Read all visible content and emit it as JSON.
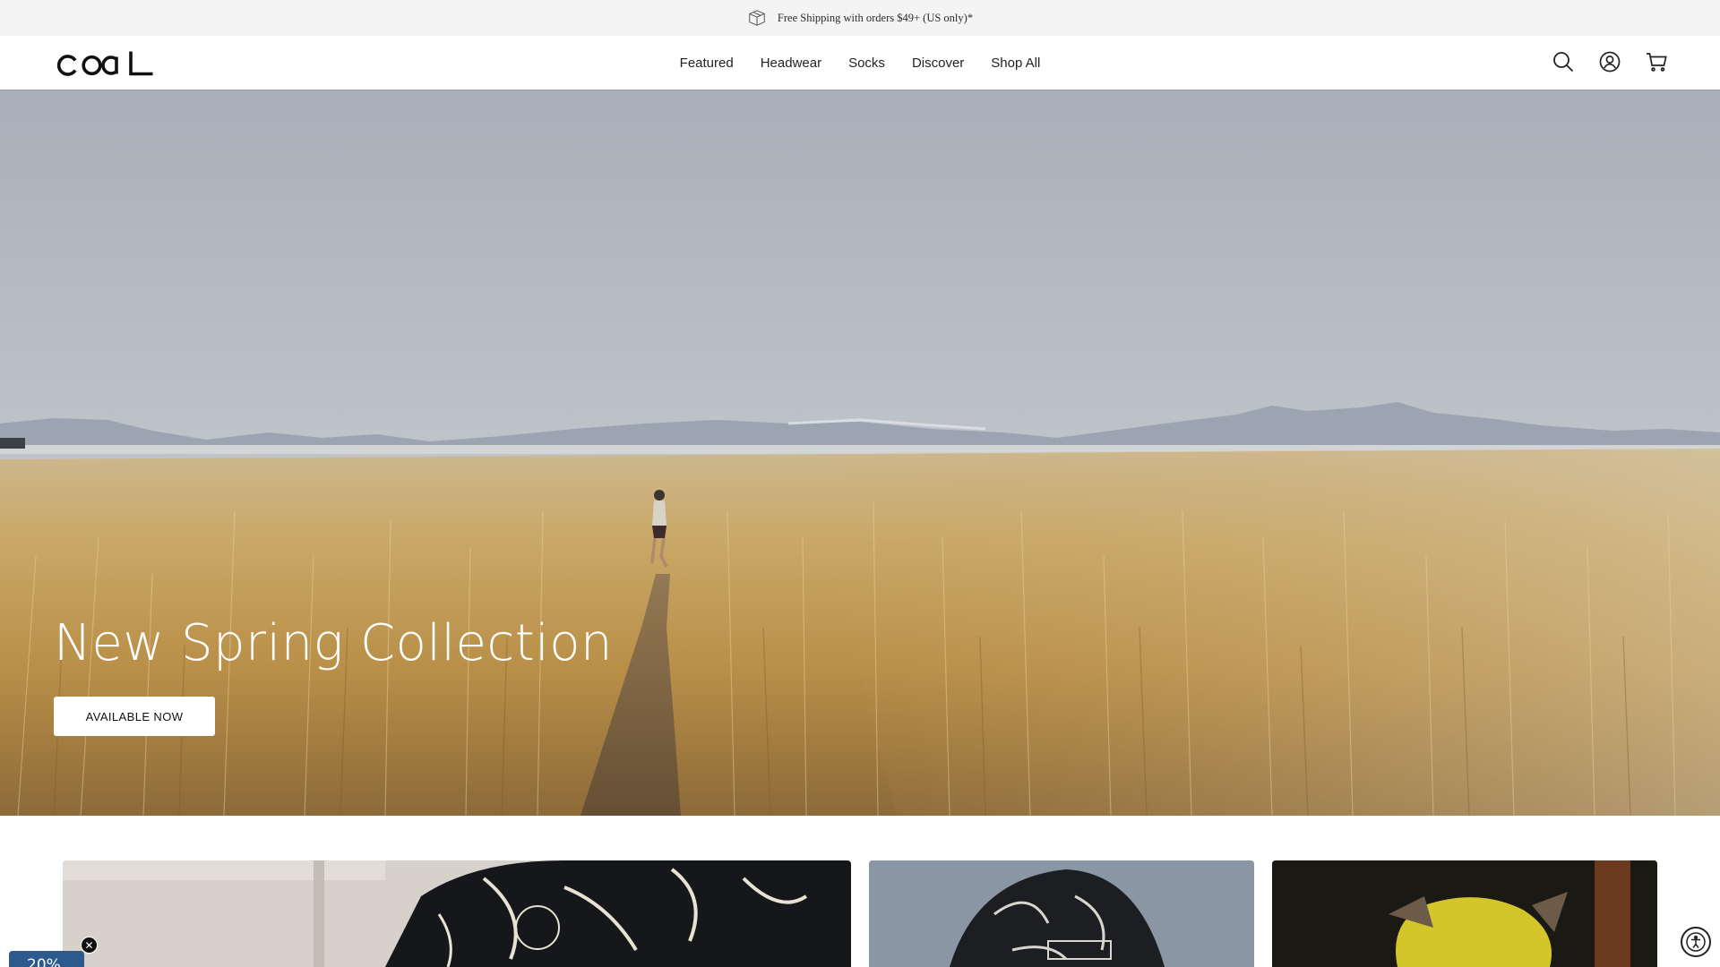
{
  "announcement": {
    "text": "Free Shipping with orders $49+ (US only)*",
    "icon": "box-icon"
  },
  "header": {
    "logo_text": "coal",
    "nav": [
      {
        "label": "Featured"
      },
      {
        "label": "Headwear"
      },
      {
        "label": "Socks"
      },
      {
        "label": "Discover"
      },
      {
        "label": "Shop All"
      }
    ],
    "icons": [
      "search-icon",
      "account-icon",
      "cart-icon"
    ]
  },
  "hero": {
    "title": "New Spring Collection",
    "cta_label": "AVAILABLE NOW"
  },
  "promo": {
    "tab_text": "20%",
    "close_icon": "close-icon"
  },
  "accessibility": {
    "icon": "accessibility-icon"
  },
  "colors": {
    "announcement_bg": "#f4f4f4",
    "promo_blue": "#2c5a8c",
    "hero_text": "#ffffff"
  }
}
